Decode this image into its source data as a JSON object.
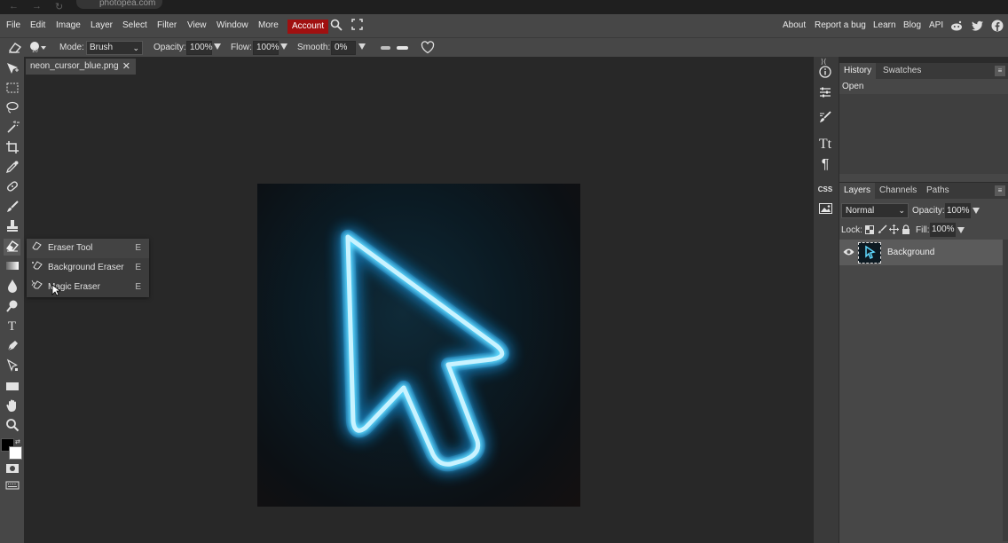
{
  "browser": {
    "url": "photopea.com",
    "back": "←",
    "forward": "→",
    "reload": "↻"
  },
  "menu": {
    "items": [
      "File",
      "Edit",
      "Image",
      "Layer",
      "Select",
      "Filter",
      "View",
      "Window",
      "More"
    ],
    "account": "Account",
    "right_links": [
      "About",
      "Report a bug",
      "Learn",
      "Blog",
      "API"
    ],
    "account_color": "#a01010"
  },
  "options": {
    "mode_label": "Mode:",
    "mode_value": "Brush",
    "opacity_label": "Opacity:",
    "opacity_value": "100%",
    "flow_label": "Flow:",
    "flow_value": "100%",
    "smooth_label": "Smooth:",
    "smooth_value": "0%",
    "brush_size": "10"
  },
  "document": {
    "tab_name": "neon_cursor_blue.png",
    "close": "✕"
  },
  "flyout": [
    {
      "label": "Eraser Tool",
      "key": "E",
      "icon": "eraser-icon"
    },
    {
      "label": "Background Eraser",
      "key": "E",
      "icon": "background-eraser-icon"
    },
    {
      "label": "Magic Eraser",
      "key": "E",
      "icon": "magic-eraser-icon"
    }
  ],
  "history": {
    "tabs": [
      "History",
      "Swatches"
    ],
    "items": [
      "Open"
    ]
  },
  "layers": {
    "tabs": [
      "Layers",
      "Channels",
      "Paths"
    ],
    "blend_mode": "Normal",
    "opacity_label": "Opacity:",
    "opacity_value": "100%",
    "lock_label": "Lock:",
    "fill_label": "Fill:",
    "fill_value": "100%",
    "items": [
      {
        "name": "Background",
        "visible": true
      }
    ]
  },
  "icon_column": {
    "css_label": "CSS",
    "type_label": "Tt",
    "paragraph_label": "¶"
  },
  "colors": {
    "neon": "#45d4ff",
    "glow": "#1ab6ff",
    "panel": "#474747",
    "canvas": "#282828"
  }
}
